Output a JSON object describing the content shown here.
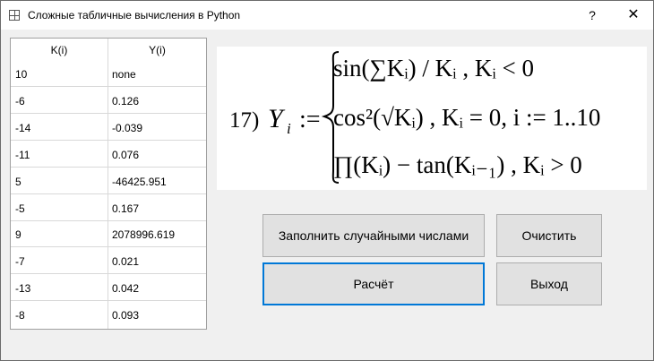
{
  "window": {
    "title": "Сложные табличные вычисления в Python",
    "help_glyph": "?",
    "close_glyph": "✕"
  },
  "table": {
    "columns": [
      "K(i)",
      "Y(i)"
    ],
    "rows": [
      {
        "k": "10",
        "y": "none"
      },
      {
        "k": "-6",
        "y": "0.126"
      },
      {
        "k": "-14",
        "y": "-0.039"
      },
      {
        "k": "-11",
        "y": "0.076"
      },
      {
        "k": "5",
        "y": "-46425.951"
      },
      {
        "k": "-5",
        "y": "0.167"
      },
      {
        "k": "9",
        "y": "2078996.619"
      },
      {
        "k": "-7",
        "y": "0.021"
      },
      {
        "k": "-13",
        "y": "0.042"
      },
      {
        "k": "-8",
        "y": "0.093"
      }
    ]
  },
  "formula": {
    "number": "17)",
    "lhs": "Y",
    "lhs_sub": "i",
    "assign": ":=",
    "case1": "sin(∑Kᵢ) / Kᵢ , Kᵢ < 0",
    "case2": "cos²(√Kᵢ) , Kᵢ = 0, i := 1..10",
    "case3": "∏(Kᵢ) − tan(Kᵢ₋₁) , Kᵢ > 0"
  },
  "buttons": {
    "fill": "Заполнить случайными числами",
    "clear": "Очистить",
    "calc": "Расчёт",
    "exit": "Выход"
  },
  "colors": {
    "focus_border": "#0078d7",
    "button_bg": "#e1e1e1",
    "window_bg": "#f0f0f0"
  }
}
